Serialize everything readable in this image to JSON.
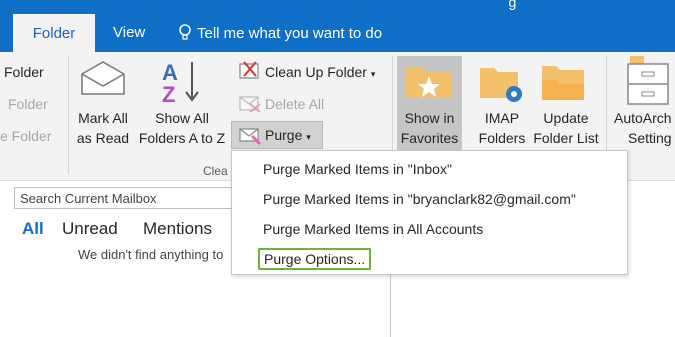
{
  "tabs": {
    "folder": "Folder",
    "view": "View",
    "tell_me": "Tell me what you want to do"
  },
  "ribbon": {
    "left_items": [
      "Folder",
      "Folder",
      "e Folder"
    ],
    "mark_all": [
      "Mark All",
      "as Read"
    ],
    "show_all": [
      "Show All",
      "Folders A to Z"
    ],
    "clean_up": "Clean Up Folder",
    "delete_all": "Delete All",
    "purge": "Purge",
    "show_fav": [
      "Show in",
      "Favorites"
    ],
    "imap": [
      "IMAP",
      "Folders"
    ],
    "update": [
      "Update",
      "Folder List"
    ],
    "autoarchive": [
      "AutoArch",
      "Setting"
    ],
    "group_label": "Clea"
  },
  "mailbox": {
    "search_placeholder": "Search Current Mailbox",
    "filters": [
      "All",
      "Unread",
      "Mentions"
    ],
    "empty": "We didn't find anything to"
  },
  "purge_menu": {
    "items": [
      "Purge Marked Items in \"Inbox\"",
      "Purge Marked Items in \"bryanclark82@gmail.com\"",
      "Purge Marked Items in All Accounts",
      "Purge Options..."
    ]
  },
  "colors": {
    "brand": "#0f6fc6",
    "focus": "#6cb33e"
  }
}
